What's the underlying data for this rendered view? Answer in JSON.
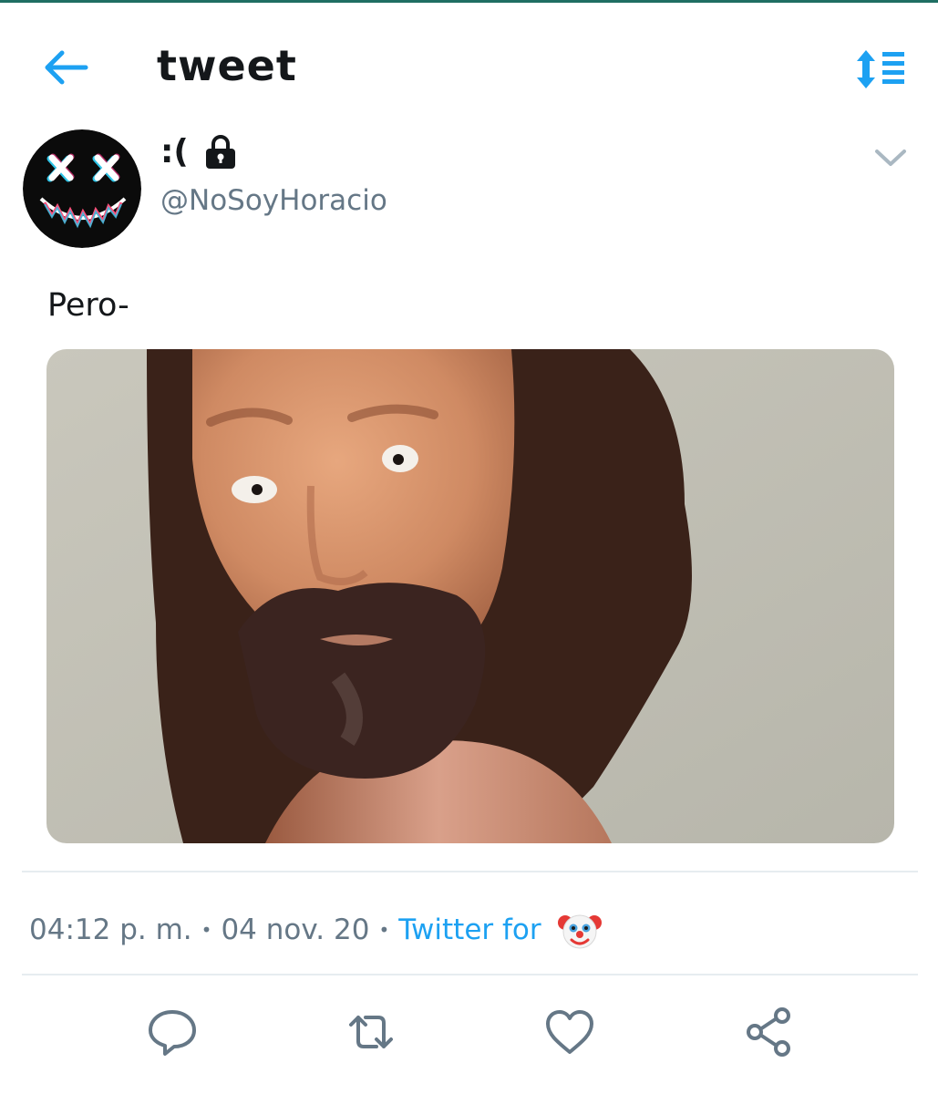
{
  "header": {
    "title": "tweet"
  },
  "tweet": {
    "author": {
      "display_name": ":(",
      "handle": "@NoSoyHoracio"
    },
    "text": "Pero-",
    "time": "04:12 p. m.",
    "separator": "•",
    "date": "04 nov. 20",
    "source_label": "Twitter for"
  },
  "icons": {
    "back": "arrow-left-icon",
    "sort": "sort-icon",
    "lock": "lock-icon",
    "caret": "chevron-down-icon",
    "source": "clown-face-icon",
    "actions": [
      "reply-icon",
      "retweet-icon",
      "like-icon",
      "share-icon"
    ]
  },
  "colors": {
    "accent": "#1da1f2",
    "secondary_text": "#657786",
    "actions": "#657786",
    "top_strip": "#1f6e63"
  }
}
